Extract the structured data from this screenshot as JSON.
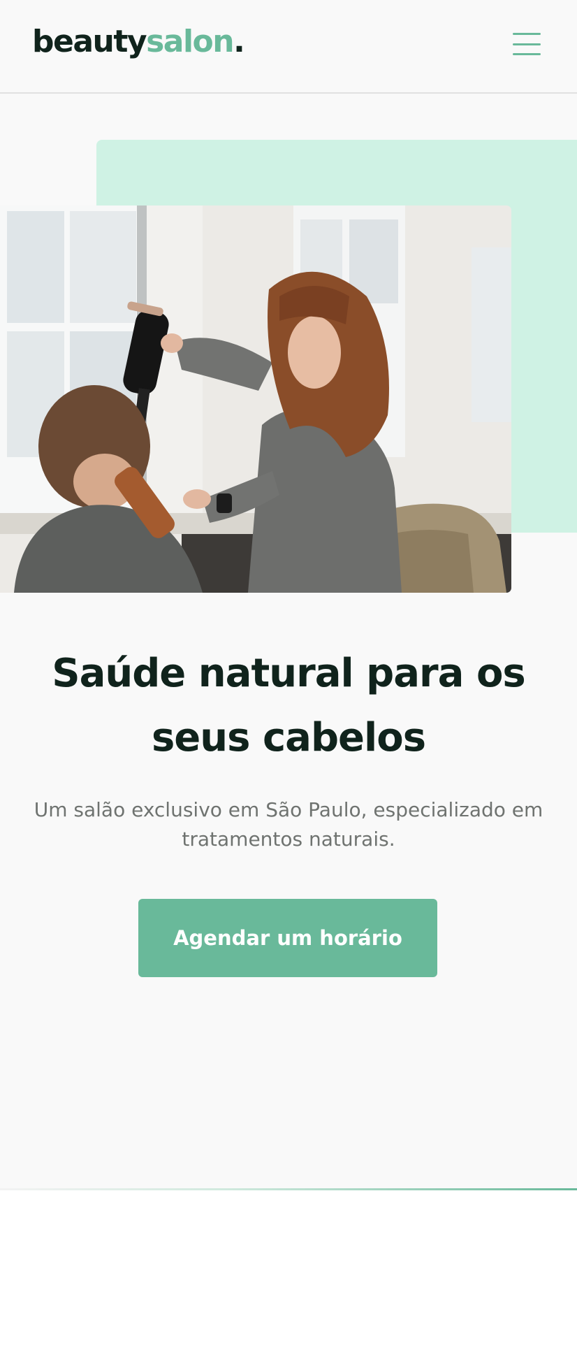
{
  "header": {
    "logo_main": "beauty",
    "logo_accent": "salon",
    "logo_dot": ".",
    "menu_icon": "hamburger-menu-icon"
  },
  "hero": {
    "image": "hairdresser-blow-drying-client-photo",
    "headline": "Saúde natural para os seus cabelos",
    "subtitle": "Um salão exclusivo em São Paulo, especializado em tratamentos naturais.",
    "cta_label": "Agendar um horário"
  },
  "colors": {
    "accent": "#69b99a",
    "accent_light": "#cff2e4",
    "text_dark": "#10231c",
    "text_muted": "#6f7370",
    "background": "#f9f9f9"
  }
}
